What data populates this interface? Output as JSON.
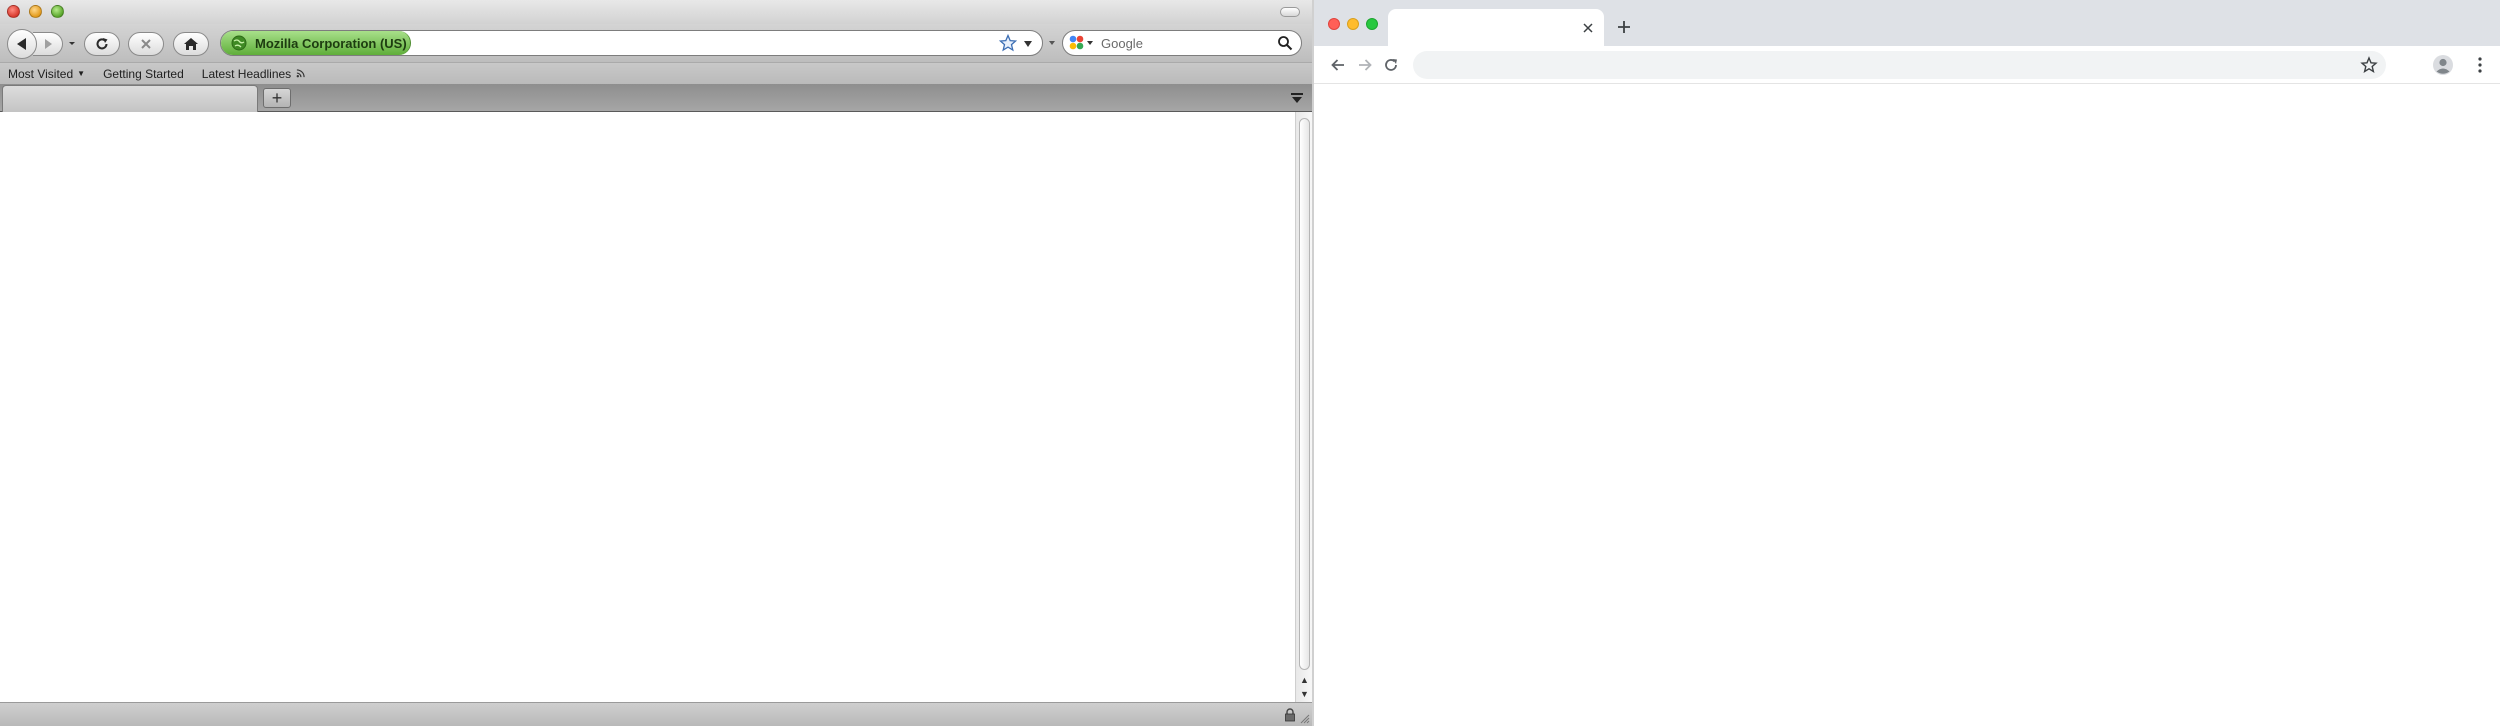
{
  "firefox": {
    "identity_label": "Mozilla Corporation (US)",
    "url_value": "",
    "search": {
      "placeholder": "Google",
      "value": ""
    },
    "bookmarks": [
      {
        "label": "Most Visited",
        "has_dropdown": true
      },
      {
        "label": "Getting Started"
      },
      {
        "label": "Latest Headlines",
        "has_feed": true
      }
    ],
    "tab_title": "",
    "new_tab_label": "+",
    "colors": {
      "identity_green": "#5fae3a",
      "chrome_gray": "#bdbdbd"
    },
    "icons": [
      "back-icon",
      "forward-icon",
      "reload-icon",
      "stop-icon",
      "home-icon",
      "bookmark-star-icon",
      "search-engine-icon",
      "search-icon",
      "lock-icon"
    ]
  },
  "chrome": {
    "tab_title": "",
    "omnibox_value": "",
    "colors": {
      "tabstrip": "#dee1e6",
      "omnibox": "#f1f3f4"
    },
    "icons": [
      "back-icon",
      "forward-icon",
      "reload-icon",
      "star-icon",
      "profile-icon",
      "menu-icon",
      "close-icon",
      "plus-icon"
    ]
  }
}
